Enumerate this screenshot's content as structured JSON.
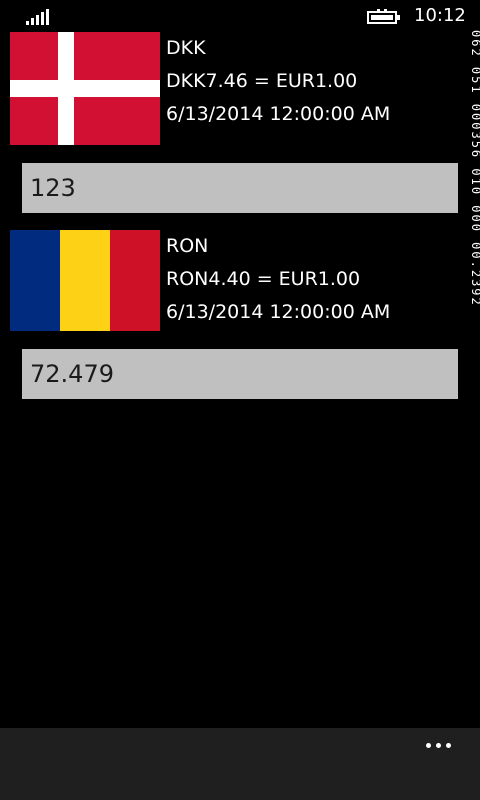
{
  "status_bar": {
    "time": "10:12",
    "signal_icon": "signal-strength-icon",
    "battery_icon": "battery-charging-icon"
  },
  "currencies": [
    {
      "code": "DKK",
      "rate": "DKK7.46 = EUR1.00",
      "date": "6/13/2014 12:00:00 AM",
      "amount": "123",
      "flag": "denmark-flag",
      "colors": {
        "red": "#d21034",
        "white": "#ffffff"
      }
    },
    {
      "code": "RON",
      "rate": "RON4.40 = EUR1.00",
      "date": "6/13/2014 12:00:00 AM",
      "amount": "72.479",
      "flag": "romania-flag",
      "colors": {
        "blue": "#002b7f",
        "yellow": "#fcd116",
        "red": "#ce1126"
      }
    }
  ],
  "side_text": "062 051 000356 010 000 00.2392",
  "app_bar": {
    "more_icon": "more-ellipsis-icon"
  },
  "theme": {
    "background": "#000000",
    "input_bg": "#c0c0c0",
    "app_bar_bg": "#1f1f1f"
  }
}
